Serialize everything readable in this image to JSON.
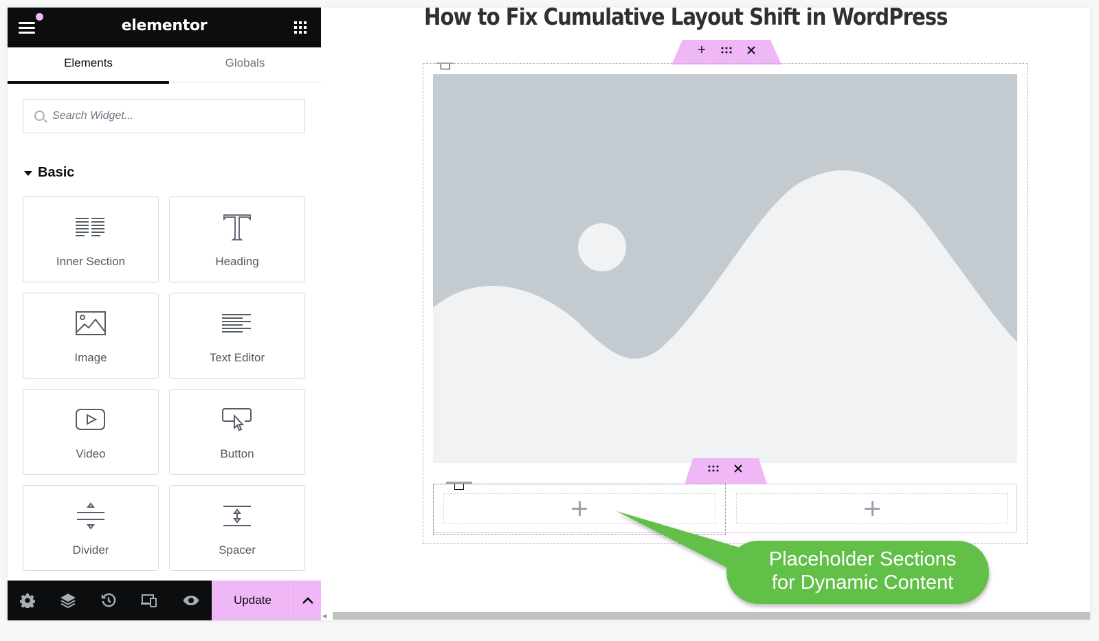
{
  "app": {
    "logo_text": "elementor",
    "accent_color": "#f0b7f7"
  },
  "topbar": {
    "menu_icon": "hamburger-icon",
    "apps_icon": "grid-icon",
    "notification_dot": true
  },
  "tabs": [
    {
      "label": "Elements",
      "active": true
    },
    {
      "label": "Globals",
      "active": false
    }
  ],
  "search": {
    "placeholder": "Search Widget...",
    "value": ""
  },
  "category": {
    "label": "Basic",
    "expanded": true
  },
  "widgets": [
    {
      "label": "Inner Section",
      "icon": "inner-section-icon"
    },
    {
      "label": "Heading",
      "icon": "heading-icon"
    },
    {
      "label": "Image",
      "icon": "image-icon"
    },
    {
      "label": "Text Editor",
      "icon": "text-editor-icon"
    },
    {
      "label": "Video",
      "icon": "video-icon"
    },
    {
      "label": "Button",
      "icon": "button-icon"
    },
    {
      "label": "Divider",
      "icon": "divider-icon"
    },
    {
      "label": "Spacer",
      "icon": "spacer-icon"
    }
  ],
  "bottombar": {
    "icons": [
      "settings-icon",
      "navigator-layers-icon",
      "history-icon",
      "responsive-mode-icon",
      "preview-eye-icon"
    ],
    "update_label": "Update"
  },
  "canvas": {
    "page_title": "How to Fix Cumulative Layout Shift in WordPress",
    "section_handle": {
      "add": "+",
      "move": "⁝⁝⁝",
      "delete": "×"
    },
    "inner_handle": {
      "move": "⁝⁝⁝",
      "delete": "×"
    },
    "columns": [
      {
        "add": "+"
      },
      {
        "add": "+"
      }
    ]
  },
  "callout": {
    "line1": "Placeholder Sections",
    "line2": "for Dynamic Content",
    "color": "#62c04a"
  }
}
